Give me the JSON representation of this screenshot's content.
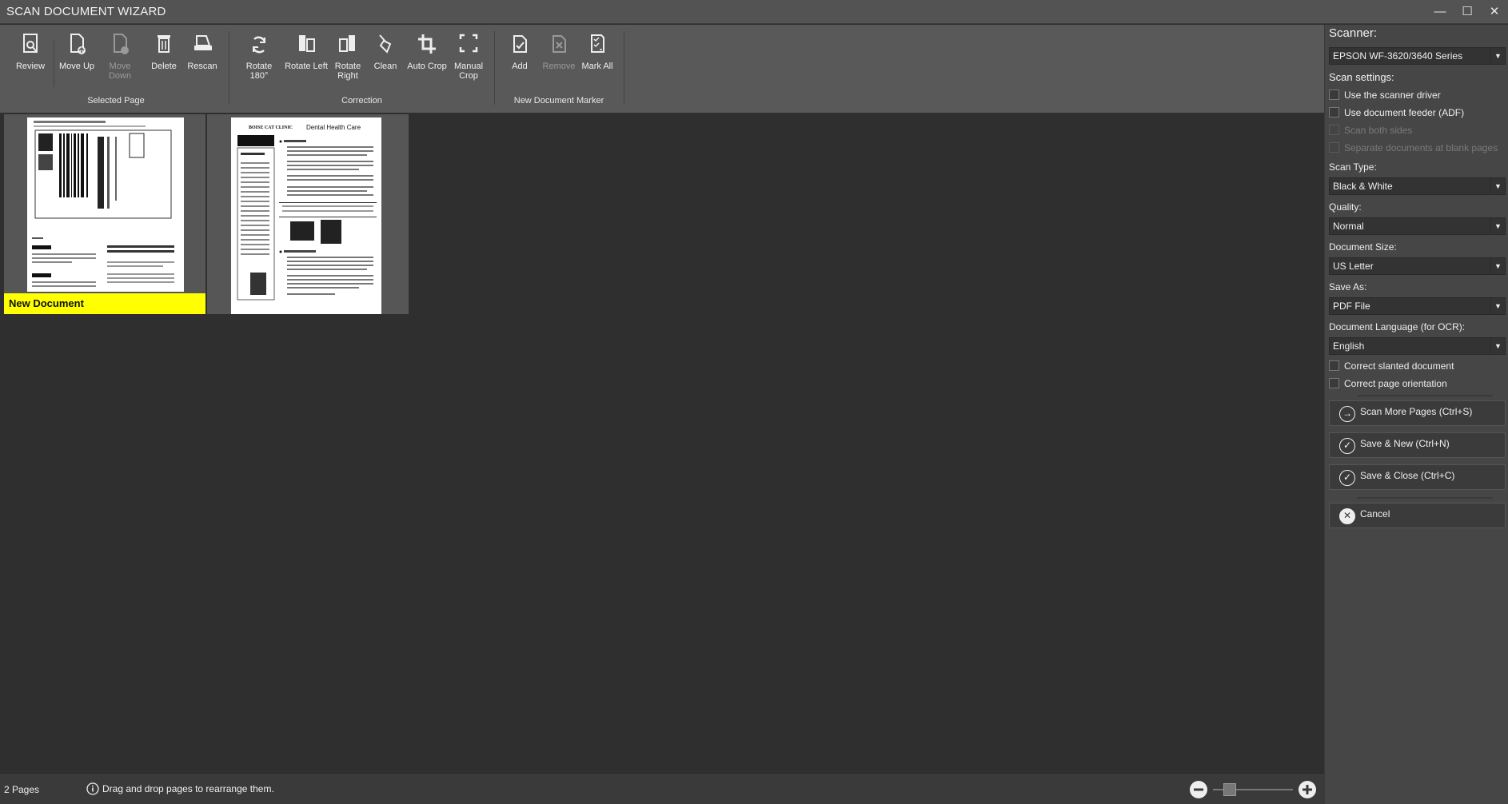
{
  "window": {
    "title": "SCAN DOCUMENT WIZARD",
    "minimize_glyph": "—",
    "maximize_glyph": "☐",
    "close_glyph": "✕"
  },
  "toolbar": {
    "review": "Review",
    "move_up": "Move Up",
    "move_down": "Move Down",
    "delete": "Delete",
    "rescan": "Rescan",
    "rotate_180": "Rotate 180°",
    "rotate_left": "Rotate Left",
    "rotate_right_1": "Rotate",
    "rotate_right_2": "Right",
    "clean": "Clean",
    "auto_crop": "Auto Crop",
    "manual_crop_1": "Manual",
    "manual_crop_2": "Crop",
    "add": "Add",
    "remove": "Remove",
    "mark_all": "Mark All",
    "group_selected_page": "Selected Page",
    "group_correction": "Correction",
    "group_new_document_marker": "New Document Marker"
  },
  "pages": {
    "marker_label": "New Document",
    "page2_title_brand": "BOISE CAT CLINIC",
    "page2_title": "Dental Health Care"
  },
  "status": {
    "page_count": "2 Pages",
    "hint": "Drag and drop pages to rearrange them."
  },
  "panel": {
    "scanner_heading": "Scanner:",
    "scanner_value": "EPSON WF-3620/3640 Series",
    "scan_settings_heading": "Scan settings:",
    "use_scanner_driver": "Use the scanner driver",
    "use_document_feeder": "Use document feeder (ADF)",
    "scan_both_sides": "Scan both sides",
    "separate_documents": "Separate documents at blank pages",
    "scan_type_label": "Scan Type:",
    "scan_type_value": "Black & White",
    "quality_label": "Quality:",
    "quality_value": "Normal",
    "document_size_label": "Document Size:",
    "document_size_value": "US Letter",
    "save_as_label": "Save As:",
    "save_as_value": "PDF File",
    "language_label": "Document Language (for OCR):",
    "language_value": "English",
    "correct_slanted": "Correct slanted document",
    "correct_orientation": "Correct page orientation",
    "scan_more": "Scan More Pages (Ctrl+S)",
    "save_new": "Save & New (Ctrl+N)",
    "save_close": "Save & Close (Ctrl+C)",
    "cancel": "Cancel"
  },
  "zoom": {
    "level": 0.15
  },
  "colors": {
    "marker": "#ffff00",
    "toolbar_bg": "#595959",
    "canvas_bg": "#2f2f2f",
    "panel_bg": "#464646"
  }
}
